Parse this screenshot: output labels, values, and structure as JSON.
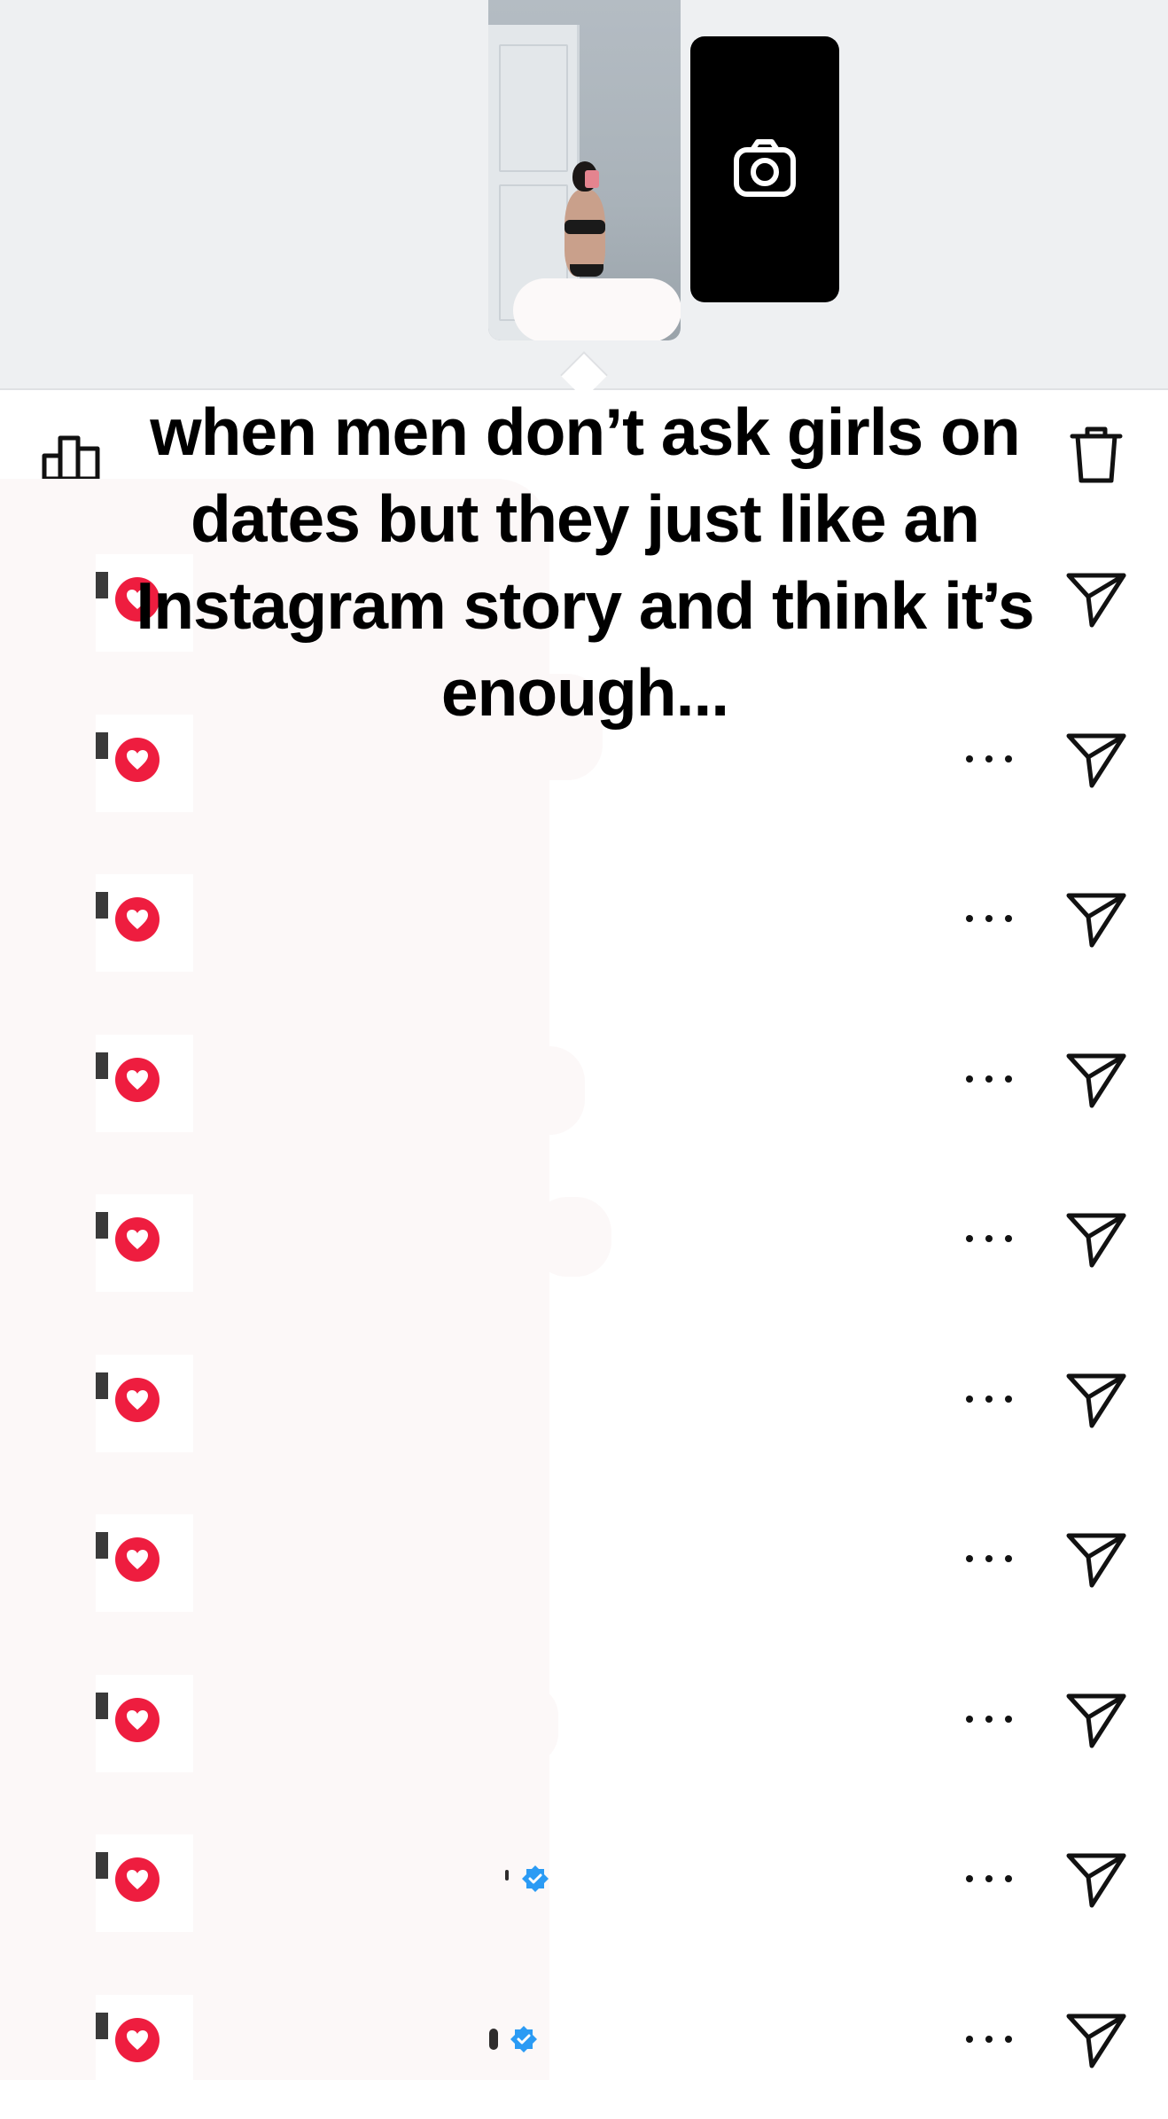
{
  "caption": {
    "line1": "when men don’t ask girls on",
    "line2": "dates but they just like an",
    "line3": "Instagram story and think it’s",
    "line4": "enough..."
  },
  "story_tray": {
    "camera_icon": "camera-icon",
    "thumbnail": "story-thumbnail"
  },
  "toolbar": {
    "insights_icon": "bar-chart-icon",
    "delete_icon": "trash-icon"
  },
  "viewers": {
    "count_shown": 10,
    "rows": [
      {
        "liked": true,
        "verified": false
      },
      {
        "liked": true,
        "verified": false
      },
      {
        "liked": true,
        "verified": false
      },
      {
        "liked": true,
        "verified": false
      },
      {
        "liked": true,
        "verified": false
      },
      {
        "liked": true,
        "verified": false
      },
      {
        "liked": true,
        "verified": false
      },
      {
        "liked": true,
        "verified": false
      },
      {
        "liked": true,
        "verified": true
      },
      {
        "liked": true,
        "verified": true
      }
    ],
    "row_icons": [
      "heart-icon",
      "more-icon",
      "send-icon"
    ]
  },
  "colors": {
    "like_red": "#ee1d3f",
    "verified_blue": "#2b9bf4",
    "header_bg": "#eef0f2",
    "redaction": "#fcf8f8"
  }
}
